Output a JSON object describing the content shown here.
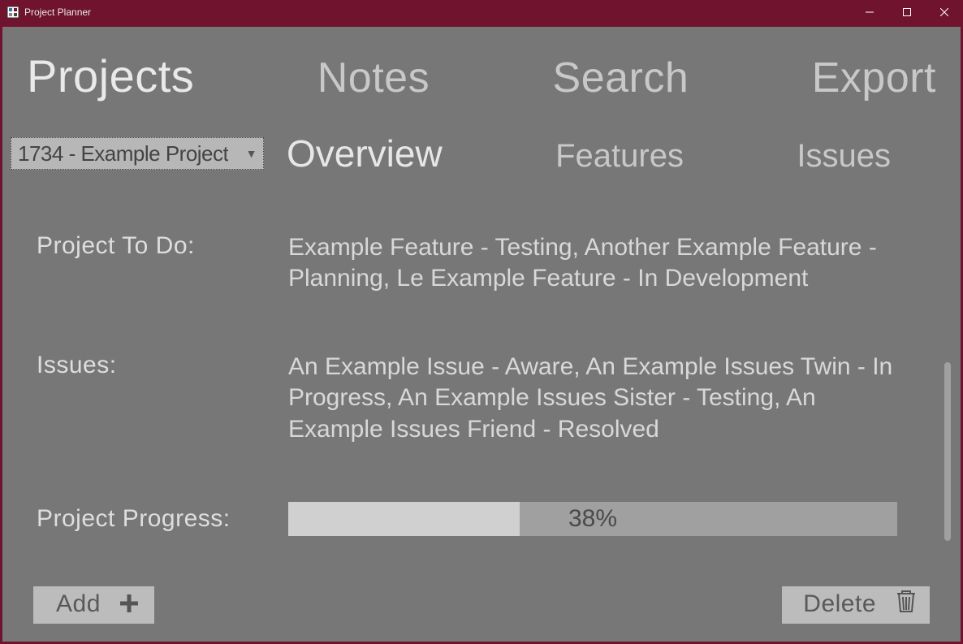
{
  "window": {
    "title": "Project Planner"
  },
  "nav": {
    "items": [
      {
        "label": "Projects",
        "active": true
      },
      {
        "label": "Notes",
        "active": false
      },
      {
        "label": "Search",
        "active": false
      },
      {
        "label": "Export",
        "active": false
      }
    ]
  },
  "project_select": {
    "selected": "1734 - Example Project"
  },
  "subtabs": {
    "items": [
      {
        "label": "Overview",
        "active": true
      },
      {
        "label": "Features",
        "active": false
      },
      {
        "label": "Issues",
        "active": false
      }
    ]
  },
  "overview": {
    "todo_label": "Project To Do:",
    "todo_value": "Example Feature - Testing, Another Example Feature - Planning, Le Example Feature - In Development",
    "issues_label": "Issues:",
    "issues_value": "An Example Issue - Aware, An Example Issues Twin - In Progress, An Example Issues Sister - Testing, An Example Issues Friend - Resolved",
    "progress_label": "Project Progress:",
    "progress_percent": 38,
    "progress_text": "38%"
  },
  "buttons": {
    "add": "Add",
    "delete": "Delete"
  }
}
